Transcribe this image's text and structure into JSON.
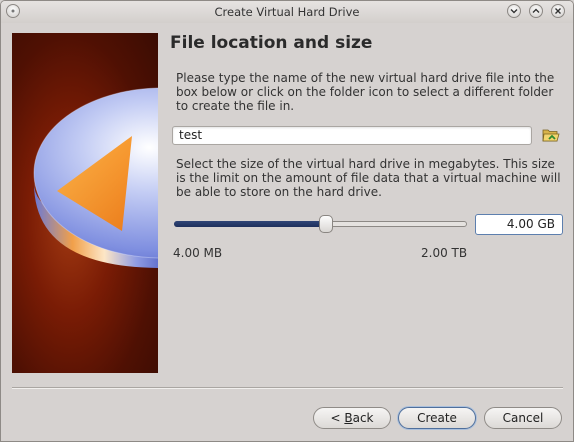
{
  "window": {
    "title": "Create Virtual Hard Drive",
    "controls": [
      "minimize",
      "maximize",
      "close"
    ]
  },
  "page": {
    "heading": "File location and size",
    "location_description": "Please type the name of the new virtual hard drive file into the box below or click on the folder icon to select a different folder to create the file in.",
    "file_name_value": "test",
    "size_description": "Select the size of the virtual hard drive in megabytes. This size is the limit on the amount of file data that a virtual machine will be able to store on the hard drive.",
    "size_value": "4.00 GB",
    "slider_min_label": "4.00 MB",
    "slider_max_label": "2.00 TB",
    "slider_fraction": 0.52
  },
  "buttons": {
    "back_prefix": "< ",
    "back_accel": "B",
    "back_rest": "ack",
    "create": "Create",
    "cancel": "Cancel"
  },
  "colors": {
    "slider_fill": "#1e2f5c",
    "side_panel": "#6a1705"
  },
  "icons": {
    "folder": "folder-open-icon",
    "titlebar_left": "window-menu-icon"
  }
}
